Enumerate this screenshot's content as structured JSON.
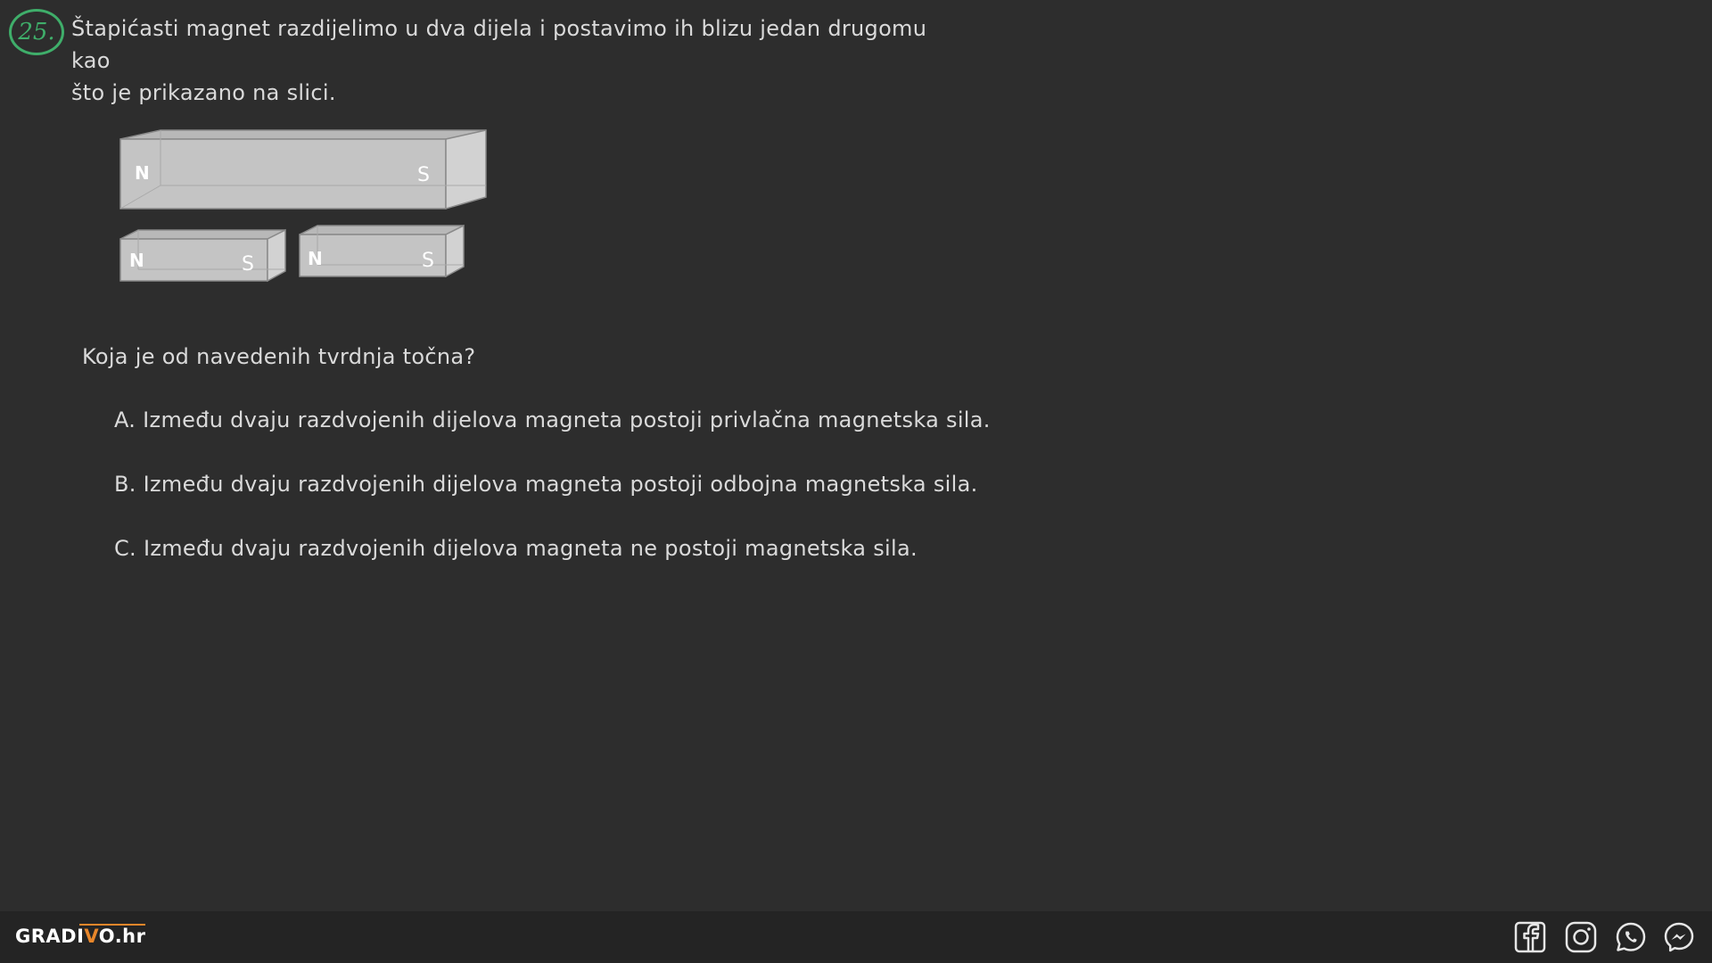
{
  "question": {
    "number": "25.",
    "text_line1": "Štapićasti magnet razdijelimo u dva dijela i postavimo ih blizu jedan drugomu kao",
    "text_line2": "što je prikazano na slici."
  },
  "figure": {
    "big_magnet": {
      "north": "N",
      "south": "S"
    },
    "left_piece": {
      "north": "N",
      "south": "S"
    },
    "right_piece": {
      "north": "N",
      "south": "S"
    },
    "colors": {
      "face": "#c4c4c4",
      "side": "#d2d2d2",
      "top": "#b8b8b8",
      "edge": "#8a8a8a"
    }
  },
  "prompt": "Koja je od navedenih tvrdnja točna?",
  "options": [
    {
      "label": "A.",
      "text": "Između dvaju razdvojenih dijelova magneta postoji privlačna magnetska sila."
    },
    {
      "label": "B.",
      "text": "Između dvaju razdvojenih dijelova magneta postoji odbojna magnetska sila."
    },
    {
      "label": "C.",
      "text": "Između dvaju razdvojenih dijelova magneta ne postoji magnetska sila."
    }
  ],
  "footer": {
    "brand_prefix": "GRADI",
    "brand_v": "V",
    "brand_suffix": "O.hr",
    "icons": [
      "facebook-icon",
      "instagram-icon",
      "whatsapp-icon",
      "messenger-icon"
    ]
  },
  "colors": {
    "background": "#2d2d2d",
    "footer": "#242424",
    "accent_green": "#3fae6a",
    "accent_orange": "#e8862a",
    "text": "#dadada"
  }
}
